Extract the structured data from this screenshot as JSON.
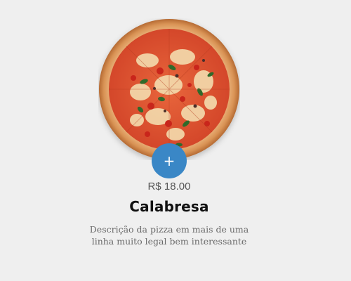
{
  "product": {
    "name": "Calabresa",
    "price": "R$ 18.00",
    "description": "Descrição da pizza em mais de uma linha muito legal bem interessante",
    "image_icon": "pizza-image"
  },
  "actions": {
    "add_label": "+"
  },
  "colors": {
    "background": "#efefef",
    "accent": "#3a87c6"
  }
}
